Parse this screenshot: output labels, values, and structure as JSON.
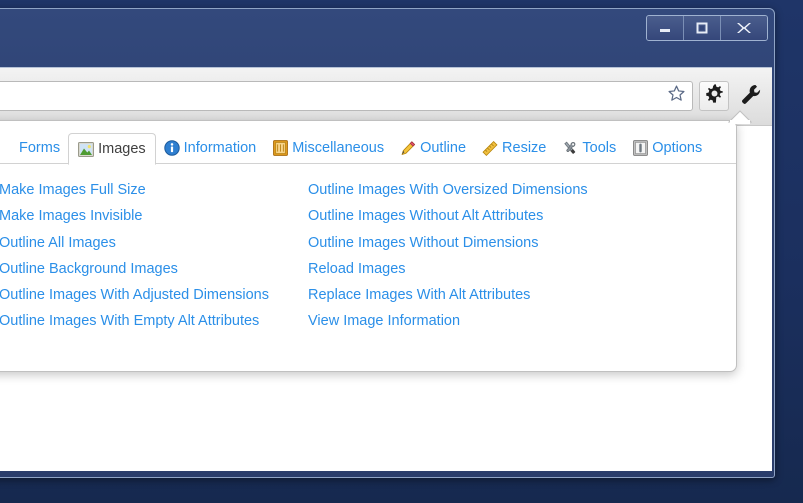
{
  "window": {
    "controls": [
      {
        "name": "minimize",
        "glyph": "minimize-icon"
      },
      {
        "name": "maximize",
        "glyph": "maximize-icon"
      },
      {
        "name": "close",
        "glyph": "close-icon"
      }
    ]
  },
  "toolbar": {
    "omnibox_value": "",
    "omnibox_placeholder": "",
    "star_icon": "star-icon",
    "gear_icon": "gear-icon",
    "wrench_icon": "wrench-icon"
  },
  "popup": {
    "tabs": [
      {
        "label": "Forms",
        "icon": "forms-icon",
        "active": false
      },
      {
        "label": "Images",
        "icon": "images-icon",
        "active": true
      },
      {
        "label": "Information",
        "icon": "information-icon",
        "active": false
      },
      {
        "label": "Miscellaneous",
        "icon": "miscellaneous-icon",
        "active": false
      },
      {
        "label": "Outline",
        "icon": "outline-icon",
        "active": false
      },
      {
        "label": "Resize",
        "icon": "resize-icon",
        "active": false
      },
      {
        "label": "Tools",
        "icon": "tools-icon",
        "active": false
      },
      {
        "label": "Options",
        "icon": "options-icon",
        "active": false
      }
    ],
    "columns": [
      {
        "items": [
          "Make Images Full Size",
          "Make Images Invisible",
          "Outline All Images",
          "Outline Background Images",
          "Outline Images With Adjusted Dimensions",
          "Outline Images With Empty Alt Attributes"
        ]
      },
      {
        "items": [
          "Outline Images With Oversized Dimensions",
          "Outline Images Without Alt Attributes",
          "Outline Images Without Dimensions",
          "Reload Images",
          "Replace Images With Alt Attributes",
          "View Image Information"
        ]
      }
    ]
  },
  "colors": {
    "link": "#2b8fe8",
    "active_tab_text": "#404040",
    "desktop": "#1d336b",
    "titlebar": "#2a3d6b",
    "panel_bg": "#ffffff",
    "panel_border": "#c0c0c0"
  }
}
